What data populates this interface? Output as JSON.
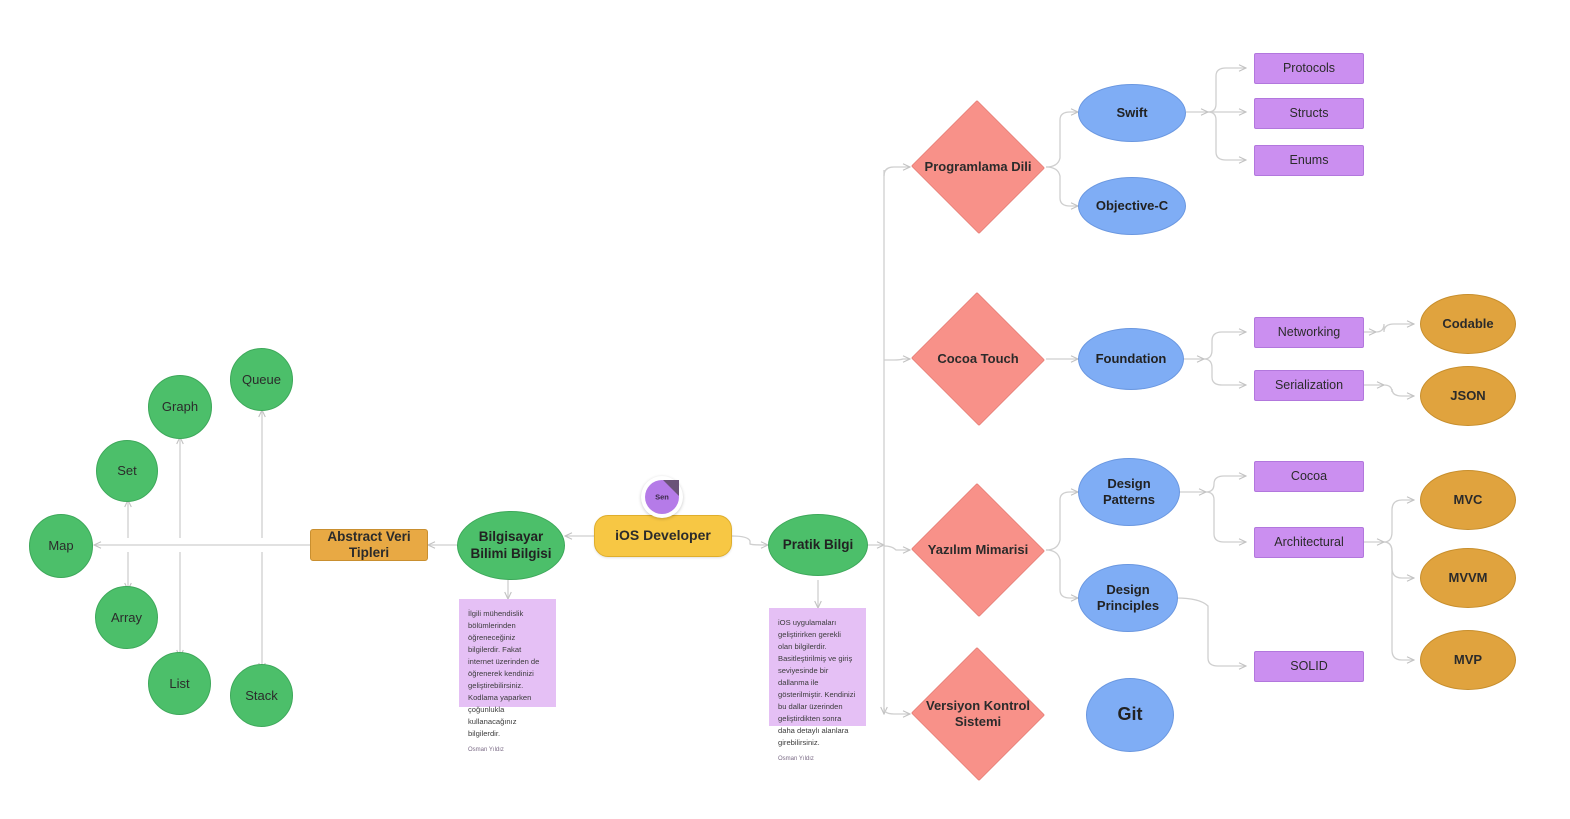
{
  "board": {
    "title": "iOS Developer Mind Map",
    "background": "#ffffff",
    "edge_color": "#c9c9c9"
  },
  "colors": {
    "green": "#4CBF6A",
    "orange_rect": "#E8A944",
    "center_yellow": "#F7C744",
    "diamond_red": "#F89189",
    "blue": "#7FADF5",
    "purple_rect": "#CB8FF0",
    "orange_ellipse": "#E0A33E",
    "note_purple": "#E5C0F5",
    "avatar_purple": "#B57BE8"
  },
  "avatar": {
    "label": "Sen",
    "icon": "user-avatar-icon"
  },
  "center": {
    "label": "iOS Developer"
  },
  "left_branch": {
    "root_label": "Bilgisayar Bilimi Bilgisi",
    "group_label": "Abstract Veri Tipleri",
    "items": [
      {
        "label": "Map"
      },
      {
        "label": "Set"
      },
      {
        "label": "Array"
      },
      {
        "label": "Graph"
      },
      {
        "label": "List"
      },
      {
        "label": "Queue"
      },
      {
        "label": "Stack"
      }
    ]
  },
  "right_branch": {
    "root_label": "Pratik Bilgi",
    "categories": [
      {
        "label": "Programlama Dili",
        "children": [
          {
            "label": "Swift",
            "children": [
              {
                "label": "Protocols"
              },
              {
                "label": "Structs"
              },
              {
                "label": "Enums"
              }
            ]
          },
          {
            "label": "Objective-C",
            "children": []
          }
        ]
      },
      {
        "label": "Cocoa Touch",
        "children": [
          {
            "label": "Foundation",
            "children": [
              {
                "label": "Networking",
                "children": [
                  {
                    "label": "Codable"
                  }
                ]
              },
              {
                "label": "Serialization",
                "children": [
                  {
                    "label": "JSON"
                  }
                ]
              }
            ]
          }
        ]
      },
      {
        "label": "Yazılım Mimarisi",
        "children": [
          {
            "label": "Design Patterns",
            "children": [
              {
                "label": "Cocoa",
                "children": []
              },
              {
                "label": "Architectural",
                "children": [
                  {
                    "label": "MVC"
                  },
                  {
                    "label": "MVVM"
                  },
                  {
                    "label": "MVP"
                  }
                ]
              }
            ]
          },
          {
            "label": "Design Principles",
            "children": [
              {
                "label": "SOLID",
                "children": []
              }
            ]
          }
        ]
      },
      {
        "label": "Versiyon Kontrol Sistemi",
        "children": [
          {
            "label": "Git",
            "children": []
          }
        ]
      }
    ]
  },
  "notes": [
    {
      "id": "note-bilgisayar",
      "text": "İlgili mühendislik bölümlerinden öğreneceğiniz bilgilerdir. Fakat internet üzerinden de öğrenerek kendinizi geliştirebilirsiniz. Kodlama yaparken çoğunlukla kullanacağınız bilgilerdir.",
      "author": "Osman Yıldız"
    },
    {
      "id": "note-pratik",
      "text": "iOS uygulamaları geliştirirken gerekli olan bilgilerdir. Basitleştirilmiş ve giriş seviyesinde bir dallanma ile gösterilmiştir. Kendinizi bu dallar üzerinden geliştirdikten sonra daha detaylı alanlara girebilirsiniz.",
      "author": "Osman Yıldız"
    }
  ]
}
